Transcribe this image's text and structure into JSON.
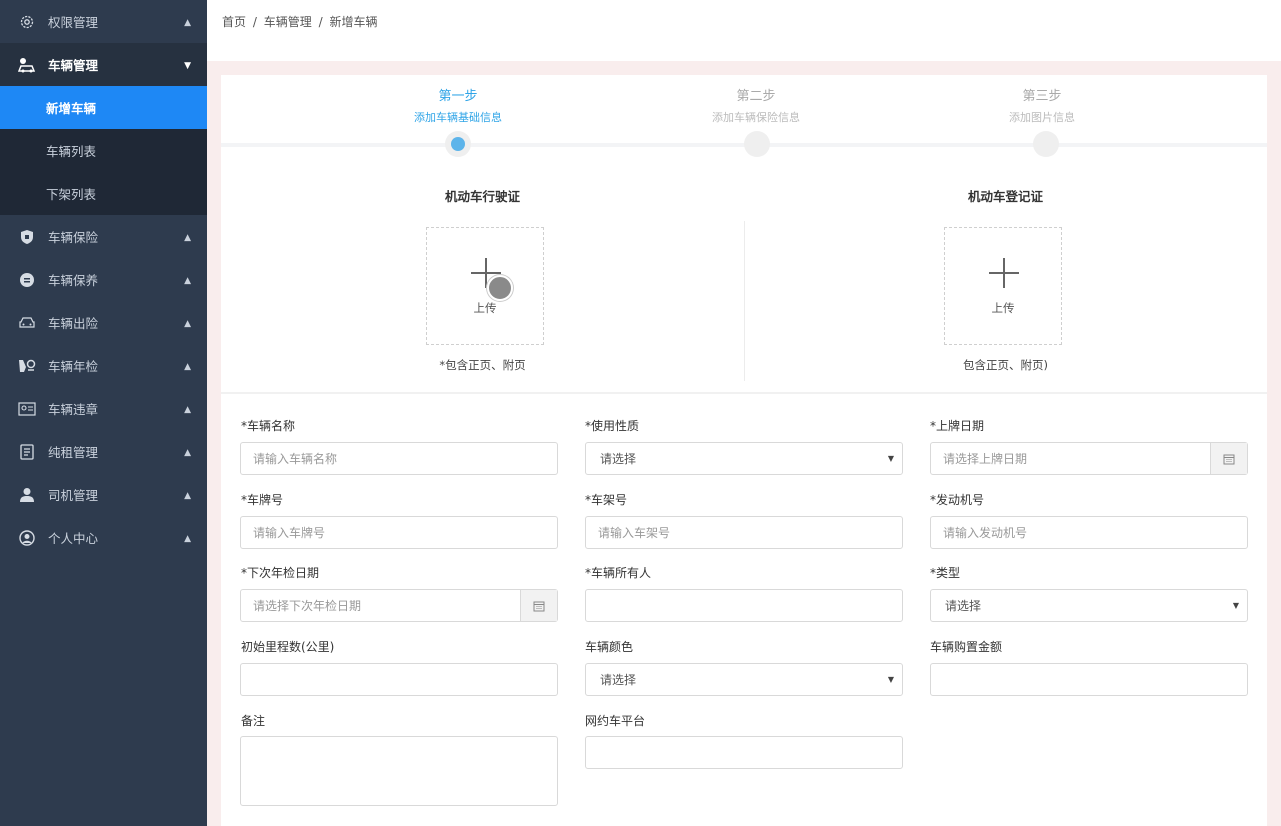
{
  "sidebar": {
    "items": [
      {
        "label": "权限管理",
        "icon": "gear-icon"
      },
      {
        "label": "车辆管理",
        "icon": "car-manage-icon"
      },
      {
        "label": "车辆保险",
        "icon": "shield-icon"
      },
      {
        "label": "车辆保养",
        "icon": "maintenance-icon"
      },
      {
        "label": "车辆出险",
        "icon": "car-icon"
      },
      {
        "label": "车辆年检",
        "icon": "inspection-icon"
      },
      {
        "label": "车辆违章",
        "icon": "violation-icon"
      },
      {
        "label": "纯租管理",
        "icon": "document-icon"
      },
      {
        "label": "司机管理",
        "icon": "driver-icon"
      },
      {
        "label": "个人中心",
        "icon": "user-icon"
      }
    ],
    "subitems": [
      {
        "label": "新增车辆",
        "active": true
      },
      {
        "label": "车辆列表",
        "active": false
      },
      {
        "label": "下架列表",
        "active": false
      }
    ]
  },
  "breadcrumb": [
    "首页",
    "/",
    "车辆管理",
    "/",
    "新增车辆"
  ],
  "steps": [
    {
      "title": "第一步",
      "subtitle": "添加车辆基础信息",
      "active": true
    },
    {
      "title": "第二步",
      "subtitle": "添加车辆保险信息",
      "active": false
    },
    {
      "title": "第三步",
      "subtitle": "添加图片信息",
      "active": false
    }
  ],
  "uploads": [
    {
      "title": "机动车行驶证",
      "button": "上传",
      "note": "*包含正页、附页"
    },
    {
      "title": "机动车登记证",
      "button": "上传",
      "note": "包含正页、附页)"
    }
  ],
  "form": {
    "vehicle_name": {
      "label": "*车辆名称",
      "placeholder": "请输入车辆名称"
    },
    "usage": {
      "label": "*使用性质",
      "value": "请选择"
    },
    "plate_date": {
      "label": "*上牌日期",
      "placeholder": "请选择上牌日期"
    },
    "plate_no": {
      "label": "*车牌号",
      "placeholder": "请输入车牌号"
    },
    "frame_no": {
      "label": "*车架号",
      "placeholder": "请输入车架号"
    },
    "engine_no": {
      "label": "*发动机号",
      "placeholder": "请输入发动机号"
    },
    "next_inspection": {
      "label": "*下次年检日期",
      "placeholder": "请选择下次年检日期"
    },
    "owner": {
      "label": "*车辆所有人",
      "placeholder": ""
    },
    "type": {
      "label": "*类型",
      "value": "请选择"
    },
    "initial_mileage": {
      "label": "初始里程数(公里)",
      "placeholder": ""
    },
    "color": {
      "label": "车辆颜色",
      "value": "请选择"
    },
    "purchase_amount": {
      "label": "车辆购置金额",
      "placeholder": ""
    },
    "remark": {
      "label": "备注"
    },
    "platform": {
      "label": "网约车平台",
      "placeholder": ""
    }
  }
}
